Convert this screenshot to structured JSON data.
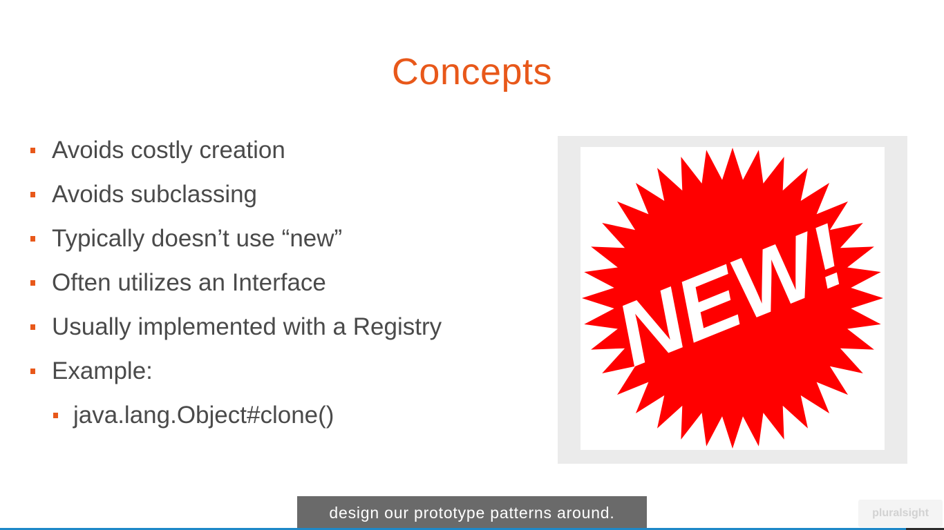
{
  "slide": {
    "title": "Concepts",
    "bullets": [
      "Avoids costly creation",
      "Avoids subclassing",
      "Typically doesn’t use “new”",
      "Often utilizes an Interface",
      "Usually implemented with a Registry",
      "Example:"
    ],
    "sub_bullets": [
      "java.lang.Object#clone()"
    ],
    "image": {
      "text": "NEW!",
      "burst_color": "#ff0000",
      "text_color": "#ffffff"
    }
  },
  "caption": "design our prototype patterns around.",
  "watermark": "pluralsight",
  "colors": {
    "accent": "#e8581a",
    "body_text": "#4a4a4a",
    "frame": "#ebebeb",
    "caption_bg": "#6a6a6a"
  },
  "progress": {
    "fraction": 0.96
  }
}
